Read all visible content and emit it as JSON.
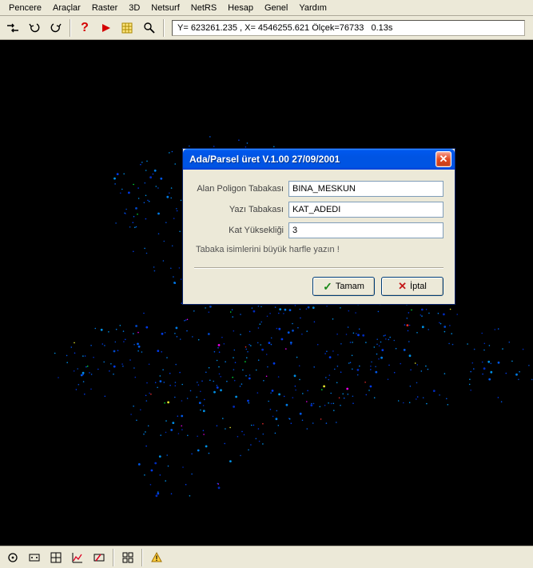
{
  "menubar": {
    "items": [
      {
        "label": "Pencere",
        "u": 0
      },
      {
        "label": "Araçlar",
        "u": 0
      },
      {
        "label": "Raster",
        "u": 0
      },
      {
        "label": "3D",
        "u": 0
      },
      {
        "label": "Netsurf",
        "u": 0
      },
      {
        "label": "NetRS",
        "u": 3
      },
      {
        "label": "Hesap",
        "u": 0
      },
      {
        "label": "Genel",
        "u": 0
      },
      {
        "label": "Yardım",
        "u": 0
      }
    ]
  },
  "statusbar": {
    "text": "Y= 623261.235 , X= 4546255.621 Ölçek=76733   0.13s"
  },
  "dialog": {
    "title": "Ada/Parsel üret V.1.00 27/09/2001",
    "fields": {
      "polygon_layer_label": "Alan Poligon Tabakası",
      "polygon_layer_value": "BINA_MESKUN",
      "text_layer_label": "Yazı Tabakası",
      "text_layer_value": "KAT_ADEDI",
      "floor_height_label": "Kat Yüksekliği",
      "floor_height_value": "3"
    },
    "hint": "Tabaka isimlerini büyük harfle yazın !",
    "buttons": {
      "ok": "Tamam",
      "cancel": "İptal"
    }
  }
}
